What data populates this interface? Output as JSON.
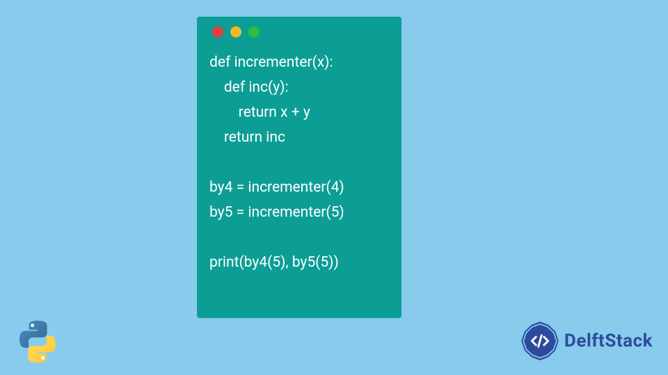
{
  "code_block": {
    "lines": [
      "def incrementer(x):",
      "    def inc(y):",
      "        return x + y",
      "    return inc",
      "",
      "by4 = incrementer(4)",
      "by5 = incrementer(5)",
      "",
      "print(by4(5), by5(5))"
    ],
    "traffic_lights": [
      "red",
      "yellow",
      "green"
    ]
  },
  "brand": {
    "name": "DelftStack"
  }
}
